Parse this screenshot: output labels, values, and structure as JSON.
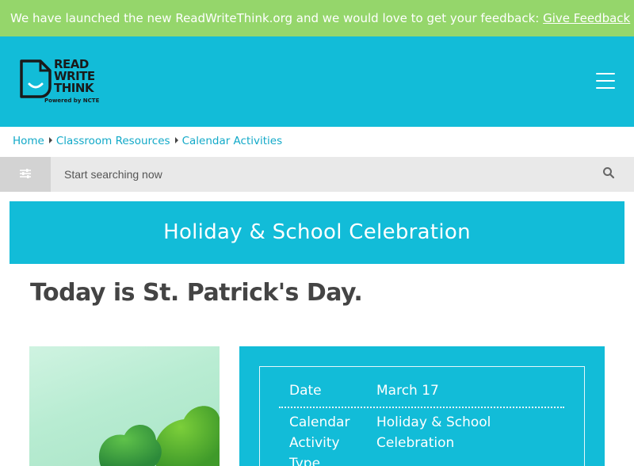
{
  "banner": {
    "message": "We have launched the new ReadWriteThink.org and we would love to get your feedback: ",
    "link_label": "Give Feedback"
  },
  "header": {
    "logo": {
      "line1": "READ",
      "line2": "WRITE",
      "line3": "THINK",
      "tagline": "Powered by NCTE"
    },
    "menu_icon": "hamburger-icon"
  },
  "breadcrumb": {
    "items": [
      "Home",
      "Classroom Resources",
      "Calendar Activities"
    ]
  },
  "search": {
    "placeholder": "Start searching now",
    "filter_icon": "filter-sliders-icon",
    "search_icon": "search-icon"
  },
  "title_block": {
    "title": "Holiday & School Celebration"
  },
  "page": {
    "heading": "Today is St. Patrick's Day."
  },
  "details": {
    "rows": [
      {
        "label": "Date",
        "value": "March 17"
      },
      {
        "label": "Calendar Activity Type",
        "value": "Holiday & School Celebration"
      }
    ]
  },
  "colors": {
    "banner": "#95d66b",
    "brand": "#12bcd8",
    "link": "#12a9c8",
    "heading": "#444444"
  }
}
